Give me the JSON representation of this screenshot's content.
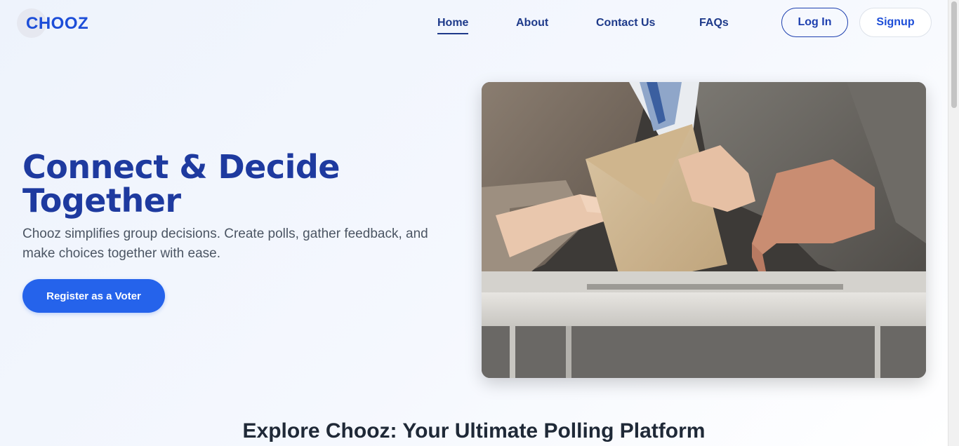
{
  "brand": {
    "logo_text": "CHOOZ"
  },
  "nav": {
    "items": [
      {
        "label": "Home",
        "active": true
      },
      {
        "label": "About",
        "active": false
      },
      {
        "label": "Contact Us",
        "active": false
      },
      {
        "label": "FAQs",
        "active": false
      }
    ],
    "login_label": "Log In",
    "signup_label": "Signup"
  },
  "hero": {
    "title": "Connect & Decide Together",
    "description": "Chooz simplifies group decisions. Create polls, gather feedback, and make choices together with ease.",
    "cta_label": "Register as a Voter",
    "image_icon": "ballot-box-photo"
  },
  "explore": {
    "title": "Explore Chooz: Your Ultimate Polling Platform"
  },
  "colors": {
    "primary": "#2563eb",
    "heading": "#1e3a9f",
    "nav_text": "#1e3a8a",
    "body_text": "#4b5563"
  }
}
